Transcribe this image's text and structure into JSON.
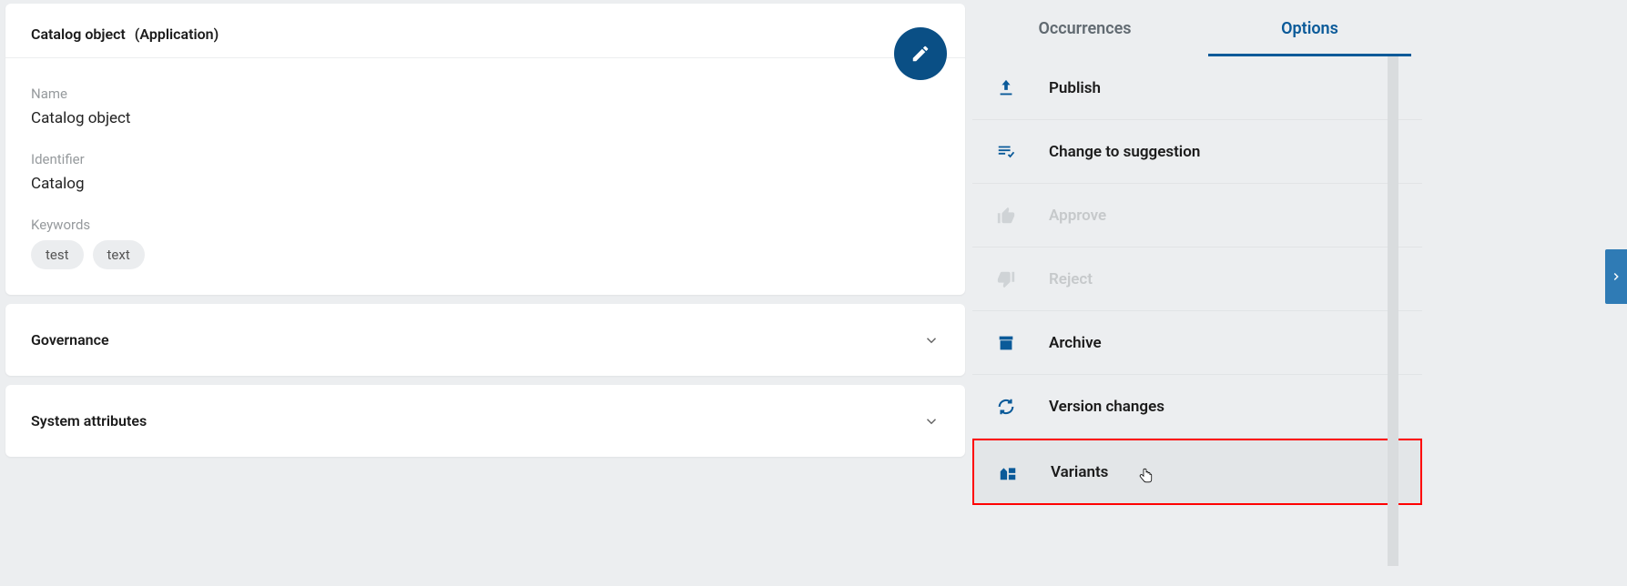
{
  "header": {
    "title": "Catalog object",
    "subtitle": "(Application)"
  },
  "details": {
    "name_label": "Name",
    "name_value": "Catalog object",
    "identifier_label": "Identifier",
    "identifier_value": "Catalog",
    "keywords_label": "Keywords",
    "keywords": [
      "test",
      "text"
    ]
  },
  "accordions": [
    {
      "title": "Governance"
    },
    {
      "title": "System attributes"
    }
  ],
  "sidepanel": {
    "tabs": [
      {
        "label": "Occurrences",
        "active": false
      },
      {
        "label": "Options",
        "active": true
      }
    ],
    "options": [
      {
        "label": "Publish",
        "icon": "publish",
        "disabled": false
      },
      {
        "label": "Change to suggestion",
        "icon": "suggest",
        "disabled": false
      },
      {
        "label": "Approve",
        "icon": "thumb-up",
        "disabled": true
      },
      {
        "label": "Reject",
        "icon": "thumb-down",
        "disabled": true
      },
      {
        "label": "Archive",
        "icon": "archive",
        "disabled": false
      },
      {
        "label": "Version changes",
        "icon": "sync",
        "disabled": false
      },
      {
        "label": "Variants",
        "icon": "variants",
        "disabled": false,
        "hovered": true
      }
    ]
  }
}
